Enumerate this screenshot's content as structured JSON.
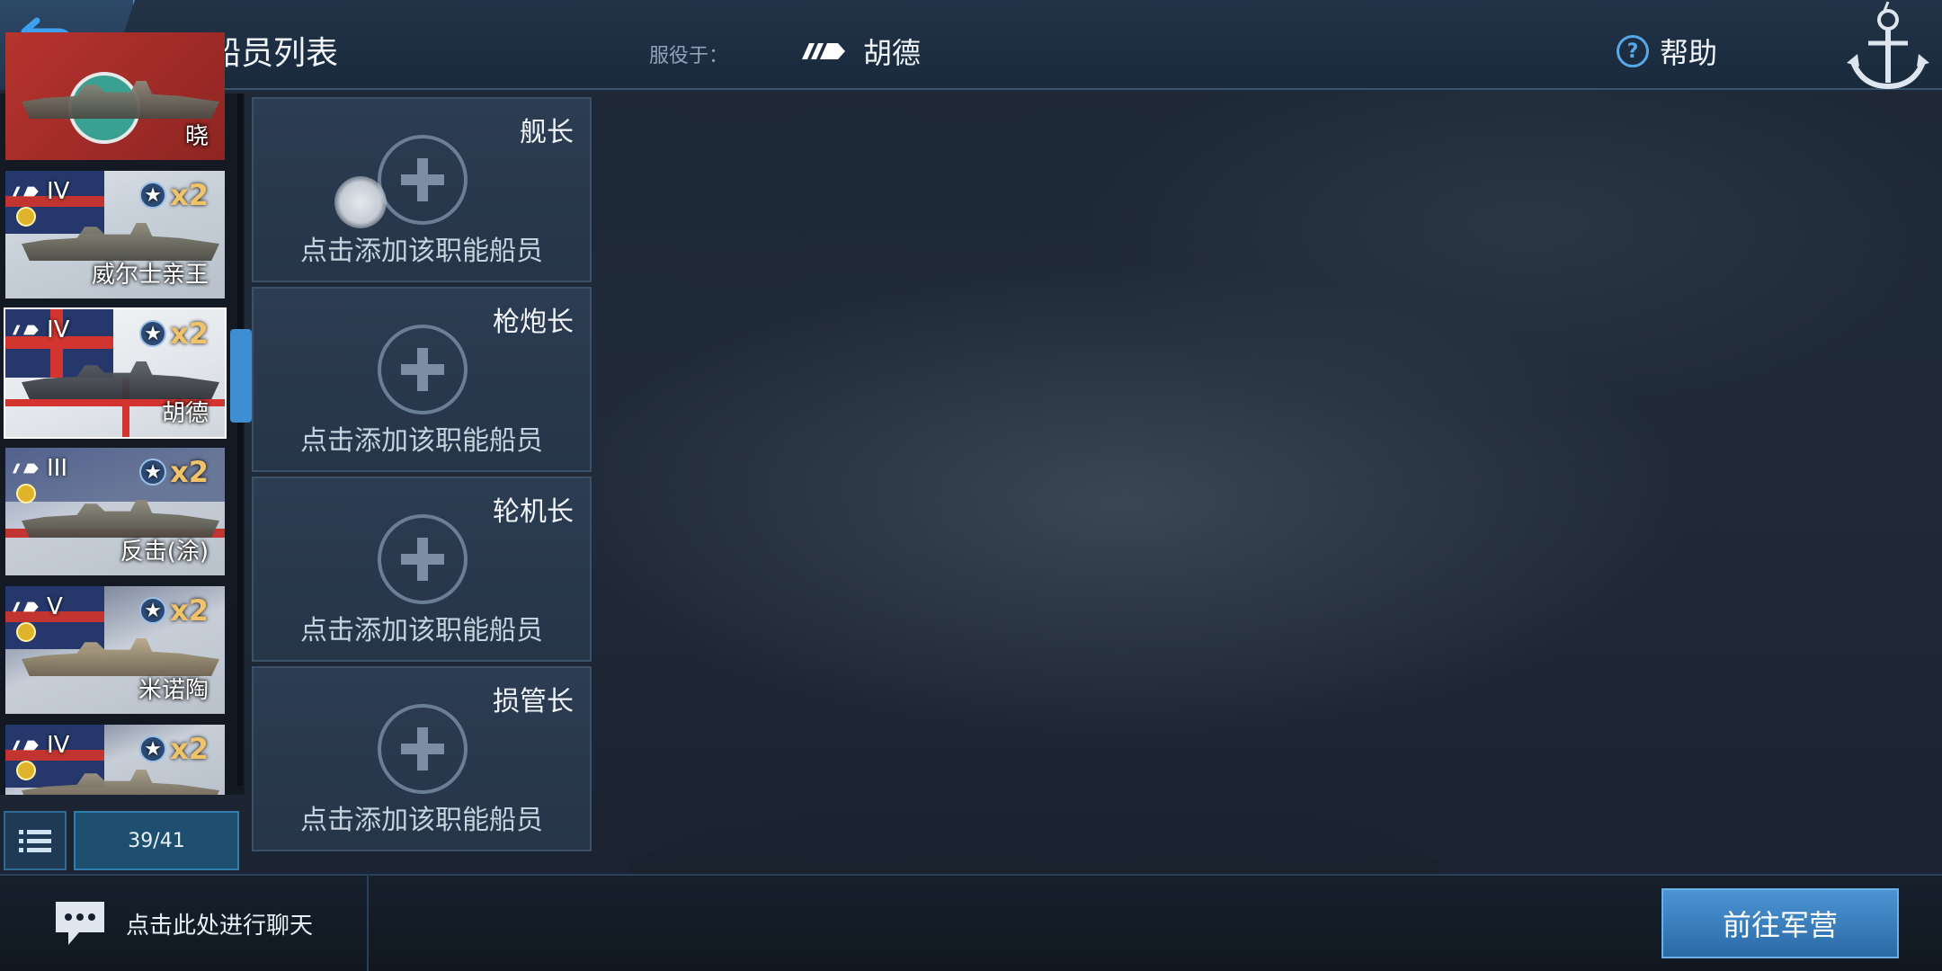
{
  "header": {
    "title": "船员列表",
    "serve_label": "服役于：",
    "serve_ship": "胡德",
    "help_label": "帮助"
  },
  "ships": [
    {
      "name": "晓",
      "tier": "",
      "multiplier": ""
    },
    {
      "name": "威尔士亲王",
      "tier": "IV",
      "multiplier": "x2"
    },
    {
      "name": "胡德",
      "tier": "IV",
      "multiplier": "x2",
      "selected": true
    },
    {
      "name": "反击(涂)",
      "tier": "III",
      "multiplier": "x2"
    },
    {
      "name": "米诺陶",
      "tier": "V",
      "multiplier": "x2"
    },
    {
      "name": "",
      "tier": "IV",
      "multiplier": "x2"
    }
  ],
  "ship_count": "39/41",
  "crew_slots": [
    {
      "role": "舰长",
      "hint": "点击添加该职能船员"
    },
    {
      "role": "枪炮长",
      "hint": "点击添加该职能船员"
    },
    {
      "role": "轮机长",
      "hint": "点击添加该职能船员"
    },
    {
      "role": "损管长",
      "hint": "点击添加该职能船员"
    }
  ],
  "footer": {
    "chat_label": "点击此处进行聊天",
    "barracks_button": "前往军营"
  },
  "colors": {
    "accent": "#3e8ed4",
    "gold": "#f0c36a"
  },
  "icons": [
    "back-arrow-icon",
    "ship-class-icon",
    "help-icon",
    "anchor-icon",
    "list-icon",
    "chat-icon",
    "plus-icon",
    "star-icon",
    "medal-icon"
  ]
}
